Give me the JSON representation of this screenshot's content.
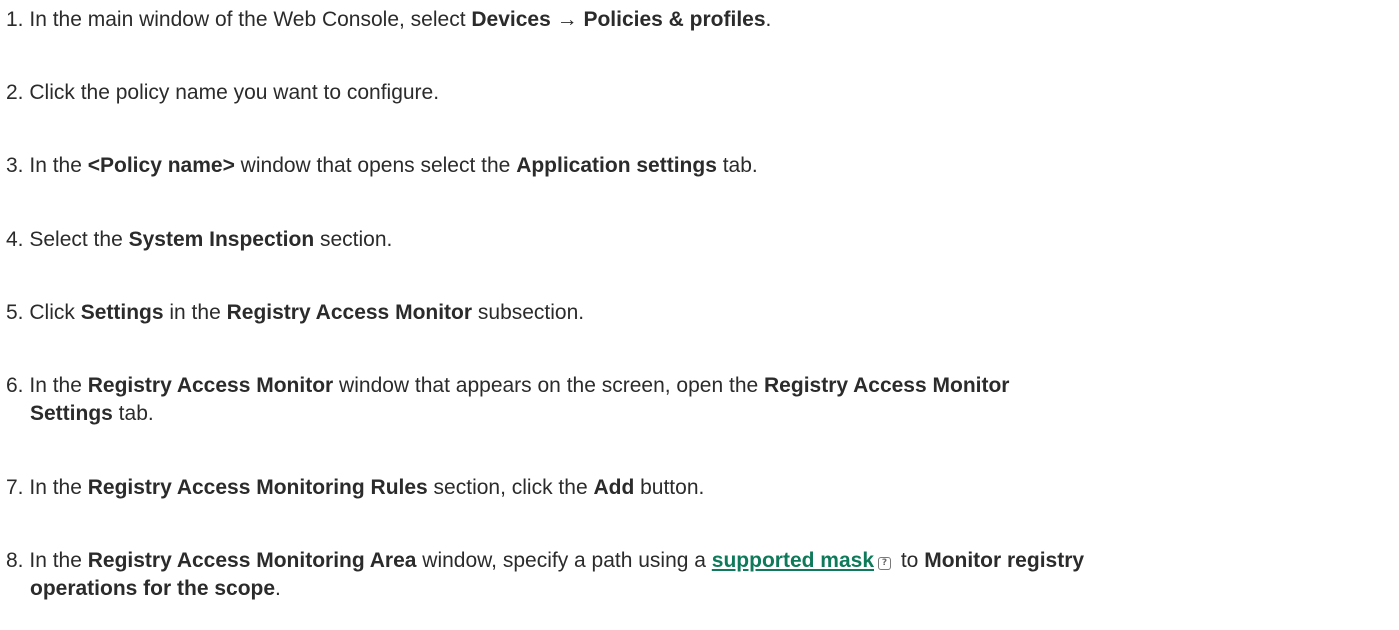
{
  "steps": [
    {
      "num": "1.",
      "parts": [
        "In the main window of the Web Console, select ",
        "Devices",
        " → ",
        "Policies & profiles",
        "."
      ]
    },
    {
      "num": "2.",
      "parts": [
        "Click the policy name you want to configure."
      ]
    },
    {
      "num": "3.",
      "parts": [
        "In the ",
        "<Policy name>",
        " window that opens select the ",
        "Application settings",
        " tab."
      ]
    },
    {
      "num": "4.",
      "parts": [
        "Select the ",
        "System Inspection",
        " section."
      ]
    },
    {
      "num": "5.",
      "parts": [
        "Click ",
        "Settings",
        " in the ",
        "Registry Access Monitor",
        " subsection."
      ]
    },
    {
      "num": "6.",
      "parts": [
        "In the ",
        "Registry Access Monitor",
        " window that appears on the screen, open the ",
        "Registry Access Monitor",
        "Settings",
        " tab."
      ]
    },
    {
      "num": "7.",
      "parts": [
        "In the ",
        "Registry Access Monitoring Rules",
        " section, click the ",
        "Add",
        " button."
      ]
    },
    {
      "num": "8.",
      "parts": [
        "In the ",
        "Registry Access Monitoring Area",
        " window, specify a path using a ",
        "supported mask",
        "?",
        " to ",
        "Monitor registry",
        "operations for the scope",
        "."
      ]
    }
  ]
}
